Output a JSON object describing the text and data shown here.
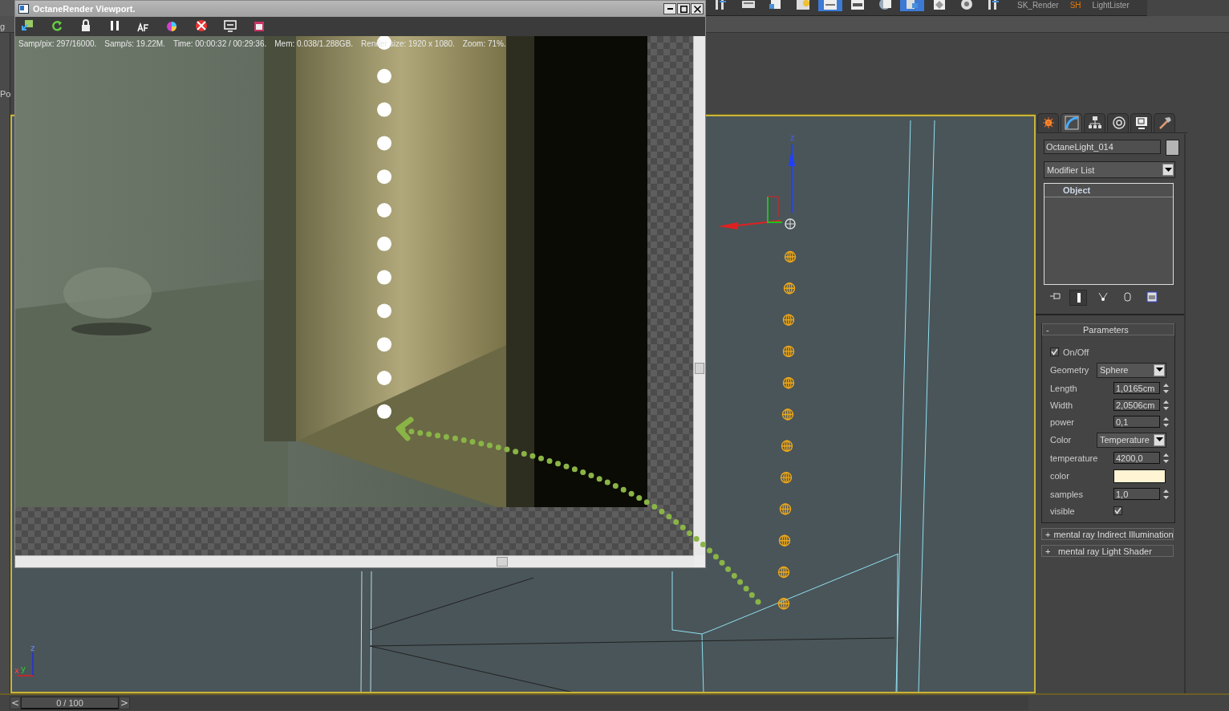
{
  "left_strip": {
    "texts": [
      "g",
      "Po"
    ]
  },
  "toolbar": {
    "buttons": [
      {
        "selected": false
      },
      {
        "selected": false
      },
      {
        "selected": false
      },
      {
        "selected": false
      },
      {
        "selected": true
      },
      {
        "selected": false
      },
      {
        "selected": false
      },
      {
        "selected": true
      },
      {
        "selected": false
      },
      {
        "selected": false
      },
      {
        "selected": false
      }
    ],
    "labels": [
      {
        "text": "SK_Render",
        "color": "#a8a8a8"
      },
      {
        "text": "SH",
        "color": "#e07a10"
      },
      {
        "text": "LightLister",
        "color": "#a8a8a8"
      }
    ]
  },
  "render_window": {
    "title": "OctaneRender Viewport.",
    "stats": [
      "Samp/pix: 297/16000.",
      "Samp/s: 19.22M.",
      "Time: 00:00:32 / 00:29:36.",
      "Mem: 0.038/1.288GB.",
      "Render size: 1920 x 1080.",
      "Zoom: 71%."
    ]
  },
  "viewport": {
    "gizmo_label": "z",
    "corner_axes": [
      "z",
      "x",
      "y"
    ]
  },
  "command_panel": {
    "tabs": [
      {
        "selected": false
      },
      {
        "selected": true
      },
      {
        "selected": false
      },
      {
        "selected": false
      },
      {
        "selected": false
      },
      {
        "selected": false
      }
    ],
    "object_name": "OctaneLight_014",
    "modifier_list": "Modifier List",
    "stack": [
      "Object"
    ],
    "parameters": {
      "toggle": "-",
      "title": "Parameters",
      "rows": [
        {
          "kind": "toggle",
          "label": "On/Off",
          "checked": true
        },
        {
          "kind": "dropdown",
          "label": "Geometry",
          "value": "Sphere"
        },
        {
          "kind": "spinner",
          "label": "Length",
          "value": "1,0165cm"
        },
        {
          "kind": "spinner",
          "label": "Width",
          "value": "2,0506cm"
        },
        {
          "kind": "spinner",
          "label": "power",
          "value": "0,1"
        },
        {
          "kind": "dropdown",
          "label": "Color",
          "value": "Temperature"
        },
        {
          "kind": "spinner",
          "label": "temperature",
          "value": "4200,0"
        },
        {
          "kind": "swatch",
          "label": "color",
          "color": "#fff4d4"
        },
        {
          "kind": "spinner",
          "label": "samples",
          "value": "1,0"
        },
        {
          "kind": "checkbox",
          "label": "visible",
          "checked": true
        }
      ]
    },
    "rollouts": [
      {
        "toggle": "+",
        "title": "mental ray Indirect Illumination"
      },
      {
        "toggle": "+",
        "title": "mental ray Light Shader"
      }
    ]
  },
  "time_slider": {
    "prev": "<",
    "position": "0 / 100",
    "next": ">",
    "level": 0
  }
}
